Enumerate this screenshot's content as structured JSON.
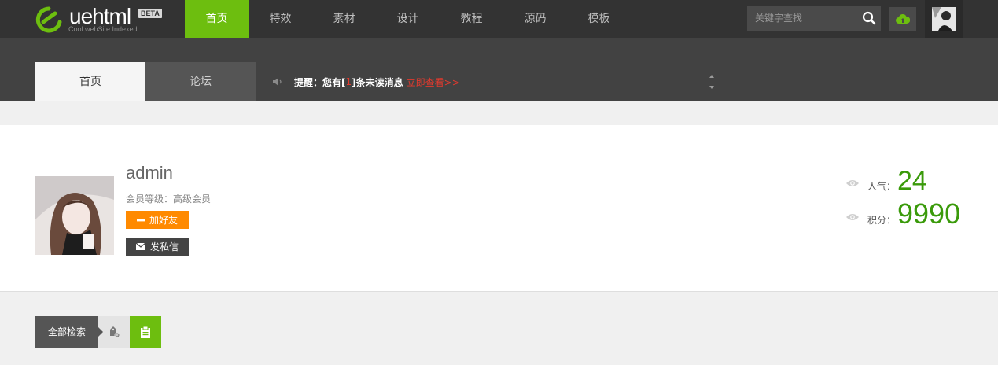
{
  "brand": {
    "wordmark": "uehtml",
    "badge": "BETA",
    "tagline": "Cool webSite Indexed",
    "accent_color": "#6dbe0f"
  },
  "nav": {
    "items": [
      {
        "label": "首页",
        "active": true
      },
      {
        "label": "特效",
        "active": false
      },
      {
        "label": "素材",
        "active": false
      },
      {
        "label": "设计",
        "active": false
      },
      {
        "label": "教程",
        "active": false
      },
      {
        "label": "源码",
        "active": false
      },
      {
        "label": "模板",
        "active": false
      }
    ]
  },
  "search": {
    "placeholder": "关键字查找",
    "icon": "search-icon"
  },
  "toolbar": {
    "upload_icon": "cloud-upload-icon",
    "avatar_icon": "user-avatar"
  },
  "tabs": [
    {
      "label": "首页",
      "active": true
    },
    {
      "label": "论坛",
      "active": false
    }
  ],
  "notice": {
    "prefix": "提醒：您有[",
    "count": "1",
    "suffix": "]条未读消息",
    "link": "立即查看>>",
    "highlight_color": "#e23a2e"
  },
  "profile": {
    "username": "admin",
    "level": "会员等级：高级会员",
    "add_friend_label": "加好友",
    "message_label": "发私信",
    "popularity_label": "人气：",
    "popularity_value": "24",
    "points_label": "积分：",
    "points_value": "9990",
    "value_color": "#3a9a0a"
  },
  "filter": {
    "all_label": "全部检索"
  }
}
